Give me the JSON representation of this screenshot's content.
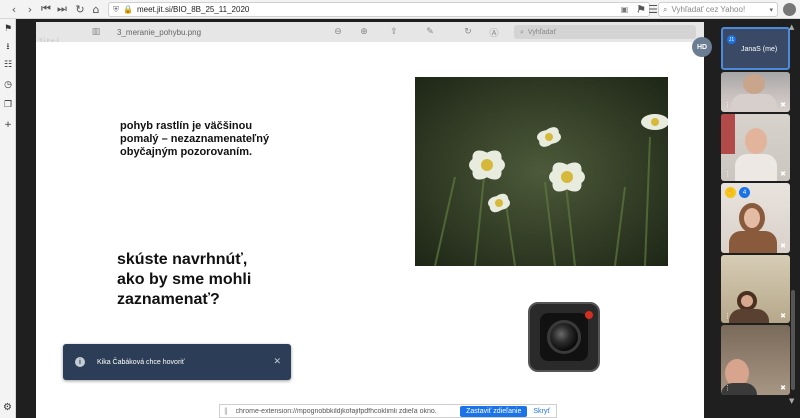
{
  "browser": {
    "url": "meet.jit.si/BIO_8B_25_11_2020",
    "search_placeholder": "Vyhľadať cez Yahoo!",
    "nav_icons": [
      "back-icon",
      "forward-icon",
      "first-icon",
      "last-icon",
      "reload-icon",
      "home-icon"
    ]
  },
  "preview": {
    "logo": "Jitsi",
    "filename": "3_meranie_pohybu.png",
    "search_placeholder": "Vyhľadať"
  },
  "slide": {
    "paragraph": "pohyb rastlín je väčšinou pomalý – nezaznamenateľný obyčajným pozorovaním.",
    "question": "skúste navrhnúť, ako by sme mohli zaznamenať?"
  },
  "notification": {
    "message": "Kika Čabáková chce hovoriť",
    "close_symbol": "✕"
  },
  "share_bar": {
    "text": "chrome-extension://mpognobbkildjkofajifpdfhcoklimli zdieľa okno.",
    "stop_label": "Zastaviť zdieľanie",
    "hide_label": "Skryť"
  },
  "participants": {
    "me_initials": "HD",
    "me_badge": "J1",
    "me_name": "JanaS (me)",
    "tile3_badge": "4"
  },
  "colors": {
    "accent_blue": "#1a73e8",
    "toast_bg": "#2c3e57",
    "conf_bg": "#1f1f1f"
  }
}
